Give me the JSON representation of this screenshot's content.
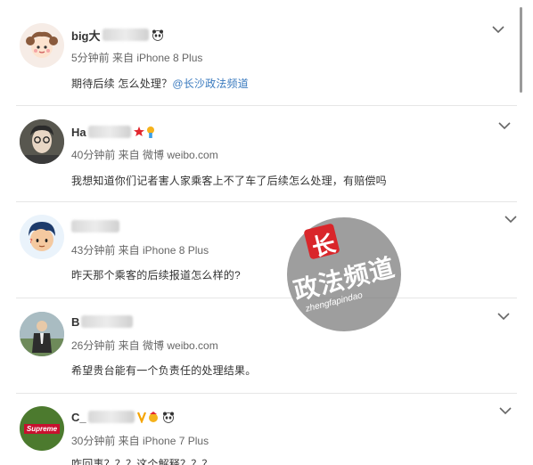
{
  "comments": [
    {
      "name_prefix": "big大",
      "meta": "5分钟前 来自 iPhone 8 Plus",
      "text": "期待后续 怎么处理？",
      "mention": "@长沙政法频道",
      "avatar_icon": "cartoon-girl-avatar",
      "badge_icon": "panda-icon"
    },
    {
      "name_prefix": "Ha",
      "meta": "40分钟前 来自 微博 weibo.com",
      "text": "我想知道你们记者害人家乘客上不了车了后续怎么处理，有赔偿吗",
      "avatar_icon": "person-photo-avatar",
      "badge_icon": "star-medal-icon"
    },
    {
      "name_prefix": "",
      "meta": "43分钟前 来自 iPhone 8 Plus",
      "text": "昨天那个乘客的后续报道怎么样的?",
      "avatar_icon": "cartoon-boy-avatar"
    },
    {
      "name_prefix": "B",
      "meta": "26分钟前 来自 微博 weibo.com",
      "text": "希望贵台能有一个负责任的处理结果。",
      "avatar_icon": "man-outdoor-avatar"
    },
    {
      "name_prefix": "C_",
      "meta": "30分钟前 来自 iPhone 7 Plus",
      "text": "咋回事？？？这个解释？？？",
      "avatar_icon": "supreme-logo-avatar",
      "avatar_label": "Supreme",
      "badge_icon": "panda-icon"
    }
  ],
  "watermark": {
    "logo_char": "长",
    "title": "政法频道",
    "subtitle": "zhengfapindao"
  },
  "colors": {
    "mention": "#3b7bbf",
    "watermark_red": "#d9262a"
  }
}
